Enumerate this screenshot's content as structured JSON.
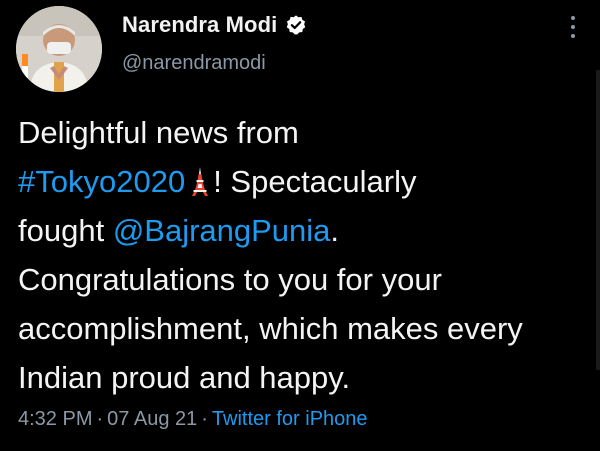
{
  "tweet": {
    "author": {
      "name": "Narendra Modi",
      "handle": "@narendramodi",
      "verified": true,
      "avatar_icon": "profile-photo"
    },
    "text": {
      "line1": "Delightful news from",
      "hashtag": "#Tokyo2020",
      "emoji_icon": "tokyo-tower-icon",
      "after_hashtag": "! Spectacularly",
      "fought": "fought ",
      "mention": "@BajrangPunia",
      "after_mention": ".",
      "rest": "Congratulations to you for your accomplishment, which makes every Indian proud and happy."
    },
    "meta": {
      "time": "4:32 PM",
      "separator": "·",
      "date": "07 Aug 21",
      "source": "Twitter for iPhone"
    }
  },
  "colors": {
    "background": "#000000",
    "link": "#1d9bf0",
    "secondary_text": "#8b98a5",
    "primary_text": "#f4f4f4"
  }
}
